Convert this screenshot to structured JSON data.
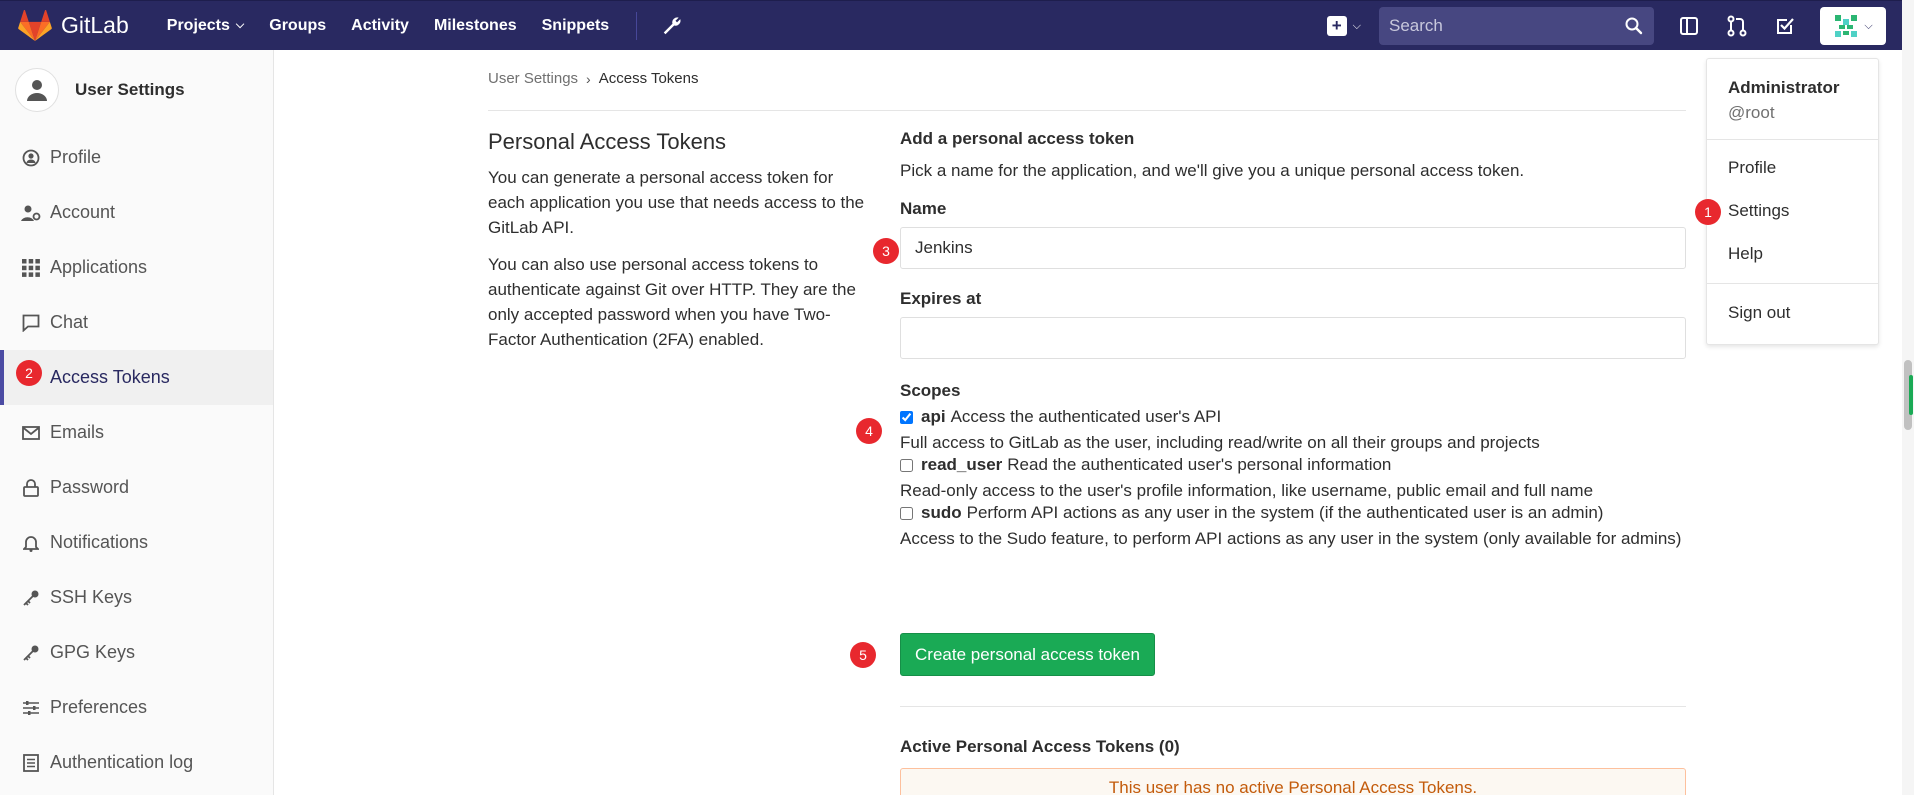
{
  "app": {
    "brand": "GitLab"
  },
  "navbar": {
    "links": [
      {
        "label": "Projects",
        "has_dropdown": true
      },
      {
        "label": "Groups"
      },
      {
        "label": "Activity"
      },
      {
        "label": "Milestones"
      },
      {
        "label": "Snippets"
      }
    ],
    "search_placeholder": "Search"
  },
  "sidebar": {
    "title": "User Settings",
    "items": [
      {
        "label": "Profile",
        "icon": "profile-icon"
      },
      {
        "label": "Account",
        "icon": "account-icon"
      },
      {
        "label": "Applications",
        "icon": "applications-icon"
      },
      {
        "label": "Chat",
        "icon": "chat-icon"
      },
      {
        "label": "Access Tokens",
        "icon": "access-tokens-icon",
        "active": true
      },
      {
        "label": "Emails",
        "icon": "envelope-icon"
      },
      {
        "label": "Password",
        "icon": "lock-icon"
      },
      {
        "label": "Notifications",
        "icon": "bell-icon"
      },
      {
        "label": "SSH Keys",
        "icon": "key-icon"
      },
      {
        "label": "GPG Keys",
        "icon": "key-icon"
      },
      {
        "label": "Preferences",
        "icon": "sliders-icon"
      },
      {
        "label": "Authentication log",
        "icon": "list-icon"
      }
    ]
  },
  "breadcrumb": {
    "parent": "User Settings",
    "current": "Access Tokens"
  },
  "intro": {
    "title": "Personal Access Tokens",
    "p1": "You can generate a personal access token for each application you use that needs access to the GitLab API.",
    "p2": "You can also use personal access tokens to authenticate against Git over HTTP. They are the only accepted password when you have Two-Factor Authentication (2FA) enabled."
  },
  "form": {
    "heading": "Add a personal access token",
    "subheading": "Pick a name for the application, and we'll give you a unique personal access token.",
    "name_label": "Name",
    "name_value": "Jenkins",
    "expires_label": "Expires at",
    "expires_value": "",
    "scopes_label": "Scopes",
    "scopes": [
      {
        "name": "api",
        "summary": "Access the authenticated user's API",
        "checked": true,
        "description": "Full access to GitLab as the user, including read/write on all their groups and projects"
      },
      {
        "name": "read_user",
        "summary": "Read the authenticated user's personal information",
        "checked": false,
        "description": "Read-only access to the user's profile information, like username, public email and full name"
      },
      {
        "name": "sudo",
        "summary": "Perform API actions as any user in the system (if the authenticated user is an admin)",
        "checked": false,
        "description": "Access to the Sudo feature, to perform API actions as any user in the system (only available for admins)"
      }
    ],
    "submit_label": "Create personal access token"
  },
  "active_tokens": {
    "heading": "Active Personal Access Tokens (0)",
    "empty_message": "This user has no active Personal Access Tokens."
  },
  "user_menu": {
    "name": "Administrator",
    "handle": "@root",
    "items": [
      "Profile",
      "Settings",
      "Help"
    ],
    "sign_out": "Sign out"
  },
  "badges": [
    "1",
    "2",
    "3",
    "4",
    "5"
  ],
  "colors": {
    "navbar": "#292961",
    "accent": "#4b4ba3",
    "success": "#1aaa55",
    "badge": "#e8282e"
  }
}
